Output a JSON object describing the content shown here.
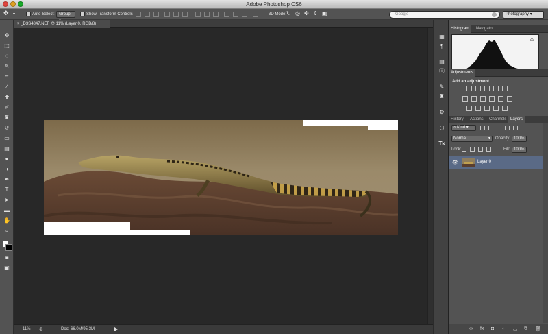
{
  "window": {
    "title": "Adobe Photoshop CS6"
  },
  "options_bar": {
    "move_tool_icon": "move-icon",
    "auto_select_label": "Auto-Select:",
    "auto_select_value": "Group",
    "transform_controls_label": "Show Transform Controls",
    "mode_3d_label": "3D Mode:",
    "search_placeholder": "Google",
    "workspace_value": "Photography"
  },
  "document": {
    "tab_label": "_D3S4847.NEF @ 11% (Layer 0, RGB/8)",
    "close_glyph": "×"
  },
  "status_bar": {
    "zoom": "11%",
    "doc_info": "Doc: 66.0M/95.3M"
  },
  "panels": {
    "histogram_tabs": [
      "Histogram",
      "Navigator"
    ],
    "histogram_warning": "⚠",
    "adjustments_tab": "Adjustments",
    "adjustments_title": "Add an adjustment",
    "layers_tabs": [
      "History",
      "Actions",
      "Channels",
      "Layers"
    ],
    "filter_kind": "Kind",
    "blend_mode": "Normal",
    "opacity_label": "Opacity:",
    "opacity_value": "100%",
    "lock_label": "Lock:",
    "fill_label": "Fill:",
    "fill_value": "100%",
    "layers": [
      {
        "name": "Layer 0",
        "visible_glyph": "👁"
      }
    ]
  },
  "colors": {
    "ui_dark": "#535353",
    "canvas_bg": "#282828",
    "selected_layer": "#5a6a86"
  }
}
